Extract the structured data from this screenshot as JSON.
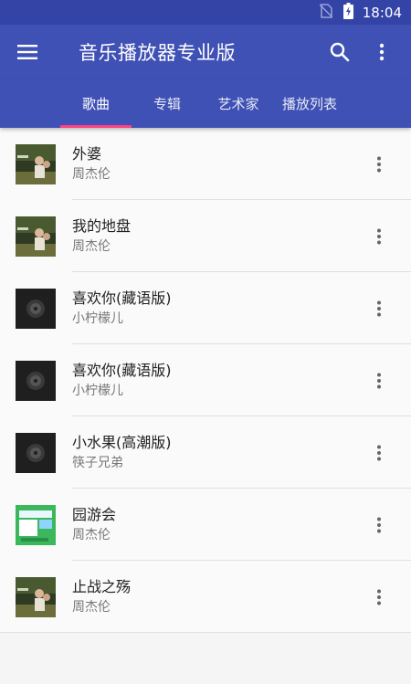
{
  "status_bar": {
    "time": "18:04"
  },
  "app_bar": {
    "title": "音乐播放器专业版"
  },
  "tabs": [
    {
      "label": "歌曲",
      "active": true
    },
    {
      "label": "专辑",
      "active": false
    },
    {
      "label": "艺术家",
      "active": false
    },
    {
      "label": "播放列表",
      "active": false
    }
  ],
  "songs": [
    {
      "title": "外婆",
      "artist": "周杰伦",
      "cover": "photo-cover-icon"
    },
    {
      "title": "我的地盘",
      "artist": "周杰伦",
      "cover": "photo-cover-icon"
    },
    {
      "title": "喜欢你(藏语版)",
      "artist": "小柠檬儿",
      "cover": "disc-cover-icon"
    },
    {
      "title": "喜欢你(藏语版)",
      "artist": "小柠檬儿",
      "cover": "disc-cover-icon"
    },
    {
      "title": "小水果(高潮版)",
      "artist": "筷子兄弟",
      "cover": "disc-cover-icon"
    },
    {
      "title": "园游会",
      "artist": "周杰伦",
      "cover": "green-cover-icon"
    },
    {
      "title": "止战之殇",
      "artist": "周杰伦",
      "cover": "photo-cover-icon"
    }
  ],
  "colors": {
    "primary": "#3f51b5",
    "status_bar": "#3343a6",
    "accent": "#ff4081"
  },
  "icons": [
    "no-sim-icon",
    "battery-charging-icon",
    "menu-icon",
    "search-icon",
    "more-vert-icon"
  ]
}
